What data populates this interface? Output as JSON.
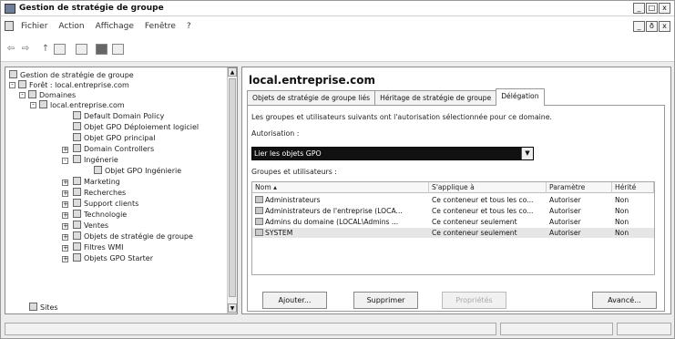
{
  "window": {
    "title": "Gestion de stratégie de groupe",
    "controls": [
      "_",
      "□",
      "x"
    ],
    "mdi_controls": [
      "_",
      "ð",
      "x"
    ]
  },
  "menu": [
    "Fichier",
    "Action",
    "Affichage",
    "Fenêtre",
    "?"
  ],
  "tree": {
    "root": "Gestion de stratégie de groupe",
    "items": [
      {
        "label": "Forêt : local.entreprise.com"
      },
      {
        "label": "Domaines"
      },
      {
        "label": "local.entreprise.com"
      },
      {
        "label": "Default Domain Policy"
      },
      {
        "label": "Objet GPO Déploiement logiciel"
      },
      {
        "label": "Objet GPO principal"
      },
      {
        "label": "Domain Controllers"
      },
      {
        "label": "Ingénerie"
      },
      {
        "label": "Objet GPO Ingénierie"
      },
      {
        "label": "Marketing"
      },
      {
        "label": "Recherches"
      },
      {
        "label": "Support clients"
      },
      {
        "label": "Technologie"
      },
      {
        "label": "Ventes"
      },
      {
        "label": "Objets de stratégie de groupe"
      },
      {
        "label": "Filtres WMI"
      },
      {
        "label": "Objets GPO Starter"
      },
      {
        "label": "Sites"
      }
    ]
  },
  "panel": {
    "title": "local.entreprise.com",
    "tabs": [
      "Objets de stratégie de groupe liés",
      "Héritage de stratégie de groupe",
      "Délégation"
    ],
    "description": "Les groupes et utilisateurs suivants ont l'autorisation sélectionnée pour ce domaine.",
    "perm_label": "Autorisation :",
    "perm_value": "Lier les objets GPO",
    "groups_label": "Groupes et utilisateurs :",
    "columns": [
      "Nom",
      "S'applique à",
      "Paramètre",
      "Hérité"
    ],
    "rows": [
      [
        "Administrateurs",
        "Ce conteneur et tous les co...",
        "Autoriser",
        "Non"
      ],
      [
        "Administrateurs de l'entreprise (LOCA...",
        "Ce conteneur et tous les co...",
        "Autoriser",
        "Non"
      ],
      [
        "Admins du domaine (LOCAL\\Admins ...",
        "Ce conteneur seulement",
        "Autoriser",
        "Non"
      ],
      [
        "SYSTEM",
        "Ce conteneur seulement",
        "Autoriser",
        "Non"
      ]
    ],
    "buttons": {
      "add": "Ajouter...",
      "remove": "Supprimer",
      "properties": "Propriétés",
      "advanced": "Avancé..."
    }
  }
}
